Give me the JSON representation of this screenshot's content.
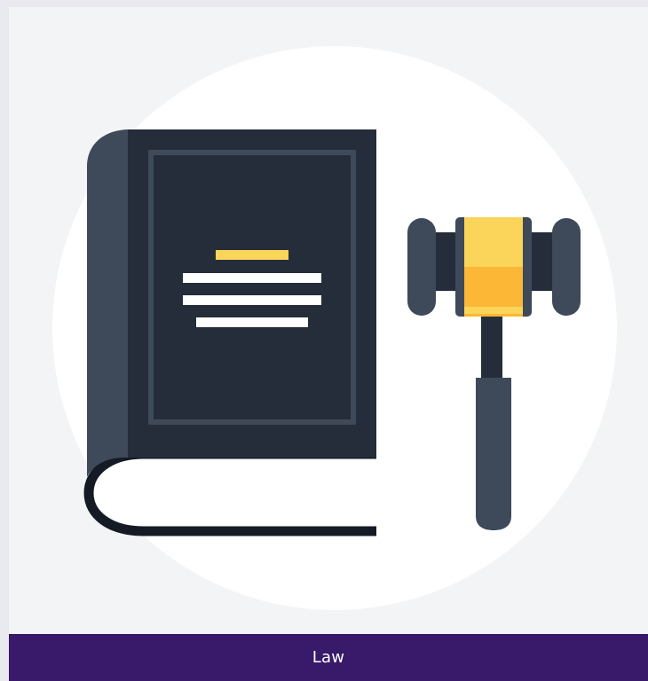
{
  "category": {
    "label": "Law",
    "icon": "law-book-and-gavel-icon"
  },
  "colors": {
    "page_background": "#e9e9ef",
    "card_background": "#f3f4f6",
    "circle_background": "#ffffff",
    "caption_background": "#39196a",
    "caption_text": "#ffffff",
    "book_cover": "#252d3a",
    "book_spine": "#3e4959",
    "accent_yellow": "#fbd45a",
    "accent_amber": "#fbb735"
  }
}
